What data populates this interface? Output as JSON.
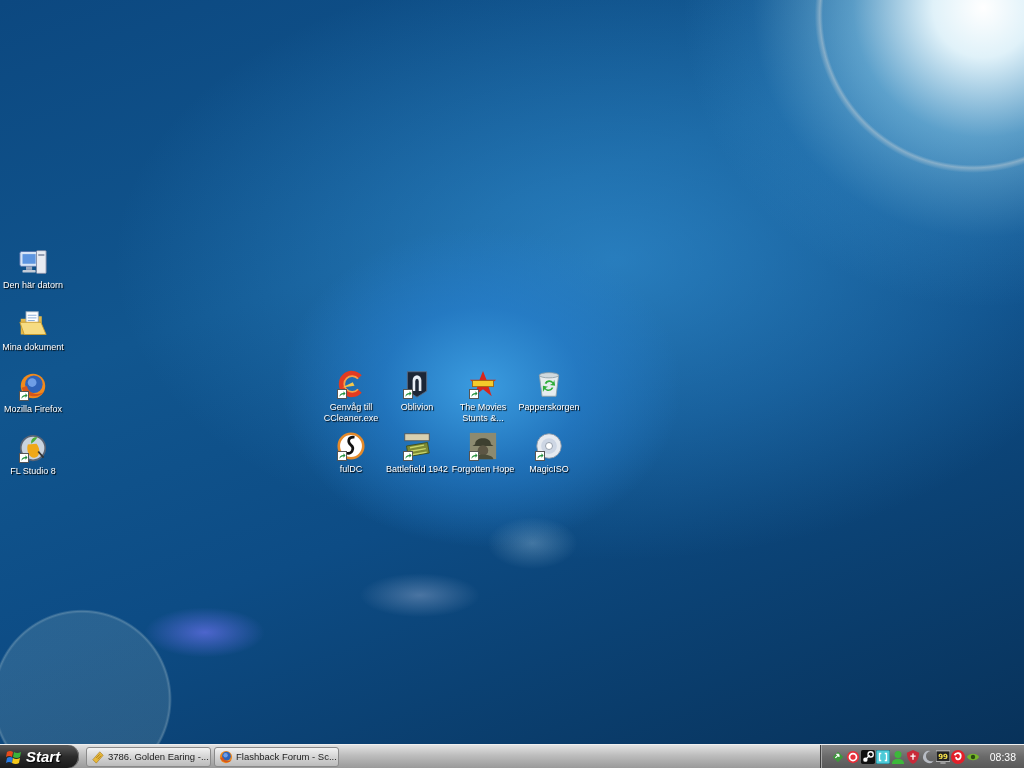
{
  "desktop": {
    "left_icons": [
      {
        "label": "Den här datorn",
        "kind": "computer",
        "shortcut": false,
        "selected": false
      },
      {
        "label": "Mina dokument",
        "kind": "folder",
        "shortcut": false,
        "selected": false
      },
      {
        "label": "Mozilla Firefox",
        "kind": "globe",
        "shortcut": true,
        "selected": false
      },
      {
        "label": "FL Studio 8",
        "kind": "fruit",
        "shortcut": true,
        "selected": false
      }
    ],
    "center_icons": [
      {
        "label": "Genvåg till CCleaner.exe",
        "kind": "cshape",
        "shortcut": true,
        "selected": false
      },
      {
        "label": "Oblivion",
        "kind": "emblem",
        "shortcut": true,
        "selected": false
      },
      {
        "label": "The Movies Stunts &...",
        "kind": "star",
        "shortcut": true,
        "selected": false
      },
      {
        "label": "Papperskorgen",
        "kind": "bin",
        "shortcut": false,
        "selected": false
      },
      {
        "label": "fulDC",
        "kind": "hook",
        "shortcut": true,
        "selected": false
      },
      {
        "label": "Battlefield 1942",
        "kind": "tank",
        "shortcut": true,
        "selected": false
      },
      {
        "label": "Forgotten Hope",
        "kind": "soldier",
        "shortcut": true,
        "selected": false
      },
      {
        "label": "MagicISO",
        "kind": "disc",
        "shortcut": true,
        "selected": false
      }
    ]
  },
  "taskbar": {
    "start_button": {
      "label": "Start"
    },
    "task_buttons": [
      {
        "label": "3786. Golden Earing -...",
        "kind": "ticket",
        "selected": false
      },
      {
        "label": "Flashback Forum - Sc...",
        "kind": "globe",
        "selected": false
      }
    ],
    "tray": {
      "icons": [
        {
          "kind": "arrow"
        },
        {
          "kind": "lifebuoy"
        },
        {
          "kind": "link"
        },
        {
          "kind": "bracket"
        },
        {
          "kind": "person"
        },
        {
          "kind": "shield"
        },
        {
          "kind": "crescent"
        },
        {
          "kind": "monitor",
          "text": "99"
        },
        {
          "kind": "swirl"
        },
        {
          "kind": "eye"
        }
      ],
      "clock": "08:38"
    }
  }
}
